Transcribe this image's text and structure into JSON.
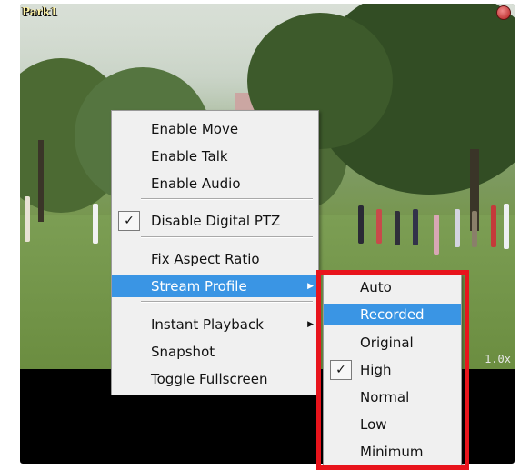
{
  "camera": {
    "name": "Park1",
    "zoom": "1.0x"
  },
  "context_menu": {
    "items": [
      {
        "label": "Enable Move"
      },
      {
        "label": "Enable Talk"
      },
      {
        "label": "Enable Audio"
      },
      {
        "label": "Disable Digital PTZ",
        "checked": true
      },
      {
        "label": "Fix Aspect Ratio"
      },
      {
        "label": "Stream Profile",
        "has_submenu": true,
        "highlighted": true
      },
      {
        "label": "Instant Playback",
        "has_submenu": true
      },
      {
        "label": "Snapshot"
      },
      {
        "label": "Toggle Fullscreen"
      }
    ]
  },
  "stream_profile_menu": {
    "items": [
      {
        "label": "Auto"
      },
      {
        "label": "Recorded",
        "highlighted": true
      },
      {
        "label": "Original"
      },
      {
        "label": "High",
        "checked": true
      },
      {
        "label": "Normal"
      },
      {
        "label": "Low"
      },
      {
        "label": "Minimum"
      }
    ]
  },
  "colors": {
    "highlight": "#3a95e4",
    "annotation_box": "#e8141c"
  },
  "icons": {
    "check": "checkmark-icon",
    "submenu": "submenu-arrow-icon",
    "close": "close-icon"
  }
}
